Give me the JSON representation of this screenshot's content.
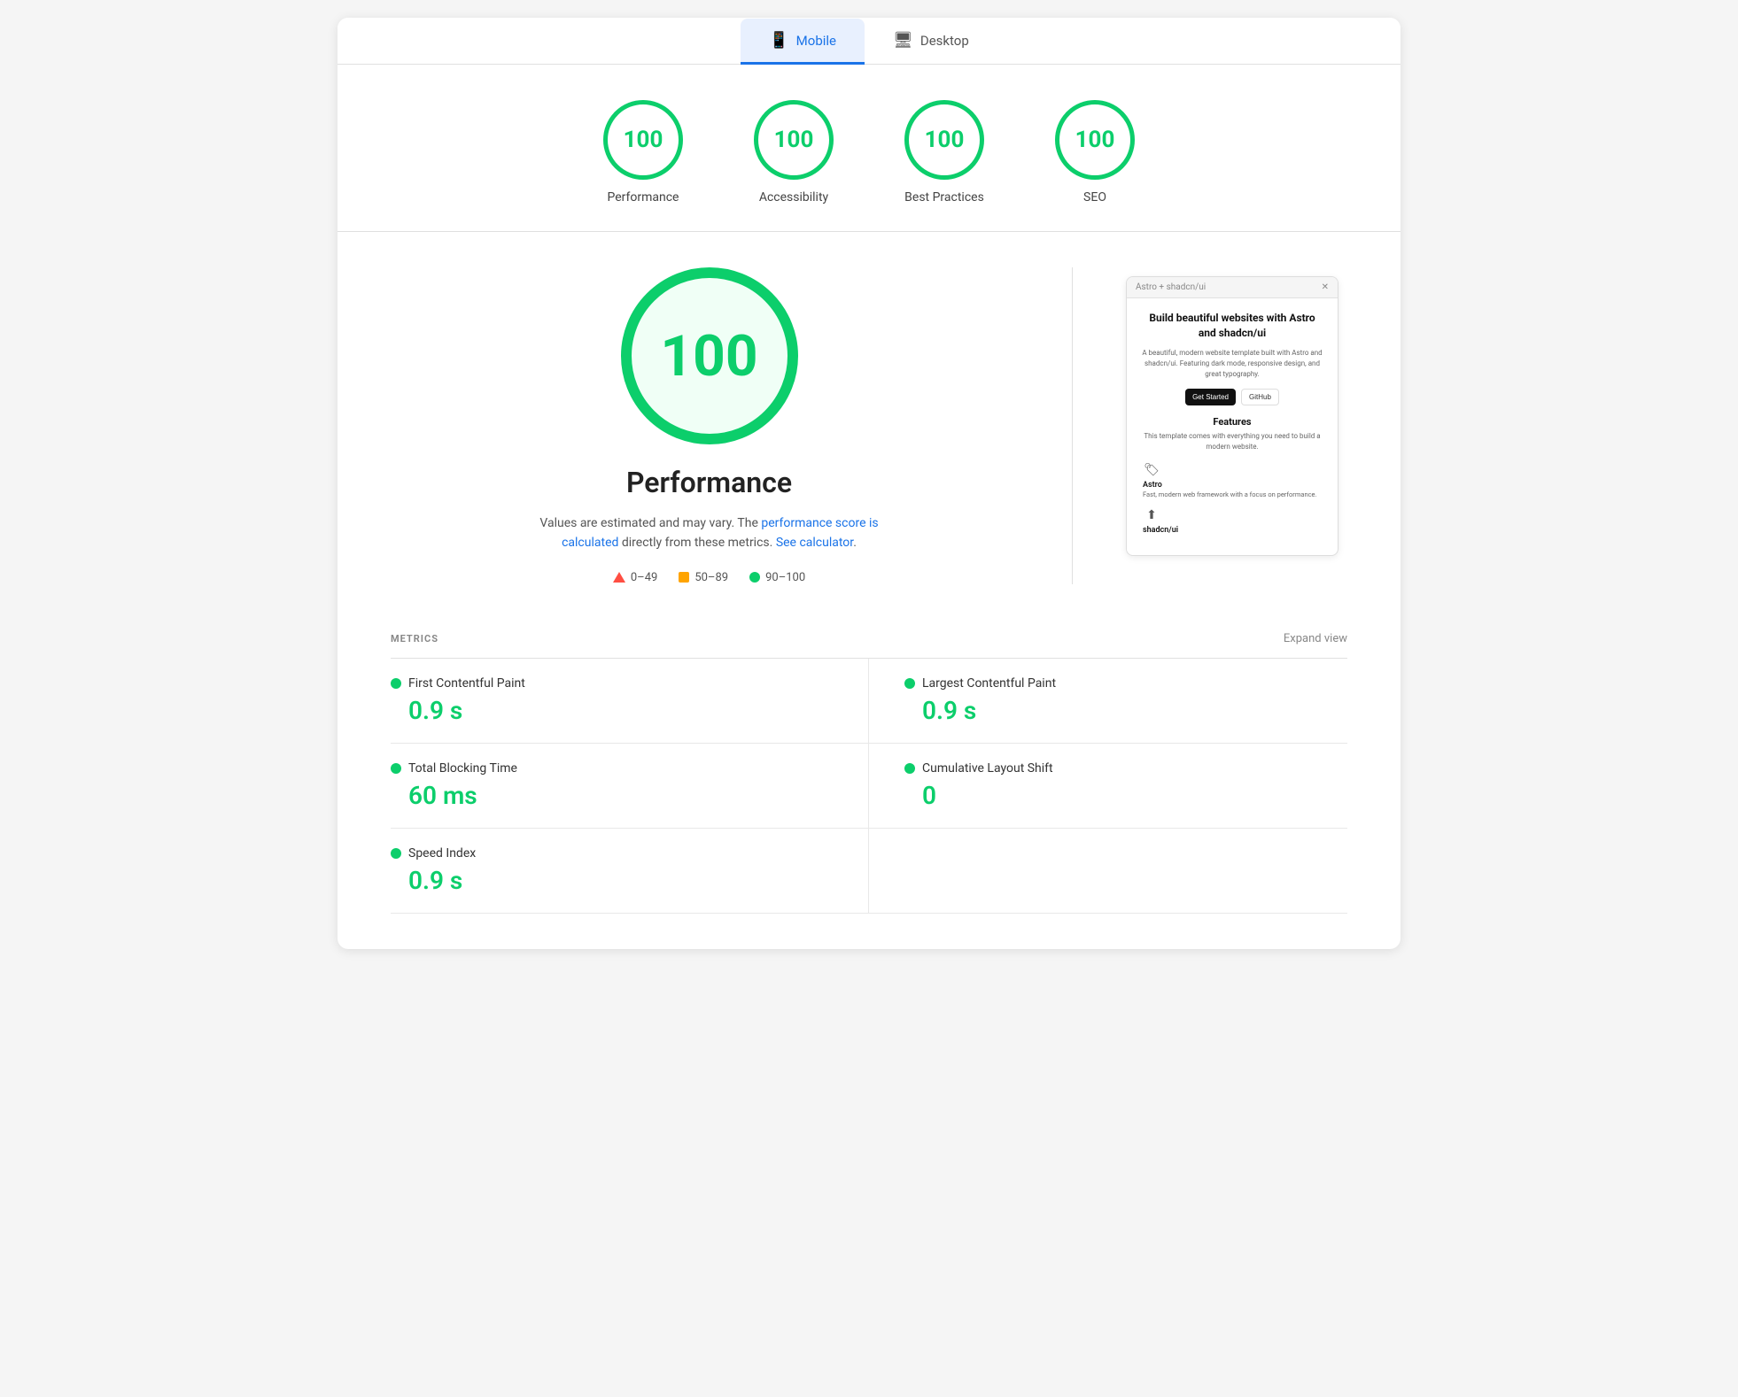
{
  "tabs": [
    {
      "id": "mobile",
      "label": "Mobile",
      "icon": "📱",
      "active": true
    },
    {
      "id": "desktop",
      "label": "Desktop",
      "icon": "🖥",
      "active": false
    }
  ],
  "scores": [
    {
      "id": "performance",
      "label": "Performance",
      "value": "100"
    },
    {
      "id": "accessibility",
      "label": "Accessibility",
      "value": "100"
    },
    {
      "id": "best-practices",
      "label": "Best Practices",
      "value": "100"
    },
    {
      "id": "seo",
      "label": "SEO",
      "value": "100"
    }
  ],
  "big_score": {
    "value": "100",
    "title": "Performance"
  },
  "description": {
    "main": "Values are estimated and may vary. The ",
    "link1": "performance score is calculated",
    "link1_end": " directly from these metrics. ",
    "link2": "See calculator",
    "link2_end": "."
  },
  "legend": [
    {
      "type": "triangle",
      "range": "0–49"
    },
    {
      "type": "square",
      "range": "50–89"
    },
    {
      "type": "circle",
      "range": "90–100"
    }
  ],
  "screenshot": {
    "title": "Astro + shadcn/ui",
    "close": "✕",
    "heading": "Build beautiful websites with Astro and shadcn/ui",
    "para": "A beautiful, modern website template built with Astro and shadcn/ui. Featuring dark mode, responsive design, and great typography.",
    "btn1": "Get Started",
    "btn2": "GitHub",
    "features_title": "Features",
    "features_para": "This template comes with everything you need to build a modern website.",
    "feature1_name": "Astro",
    "feature1_desc": "Fast, modern web framework with a focus on performance.",
    "feature2_name": "shadcn/ui",
    "feature2_icon": "⬆"
  },
  "metrics": {
    "title": "METRICS",
    "expand": "Expand view",
    "items": [
      {
        "name": "First Contentful Paint",
        "value": "0.9 s"
      },
      {
        "name": "Largest Contentful Paint",
        "value": "0.9 s"
      },
      {
        "name": "Total Blocking Time",
        "value": "60 ms"
      },
      {
        "name": "Cumulative Layout Shift",
        "value": "0"
      },
      {
        "name": "Speed Index",
        "value": "0.9 s"
      }
    ]
  }
}
